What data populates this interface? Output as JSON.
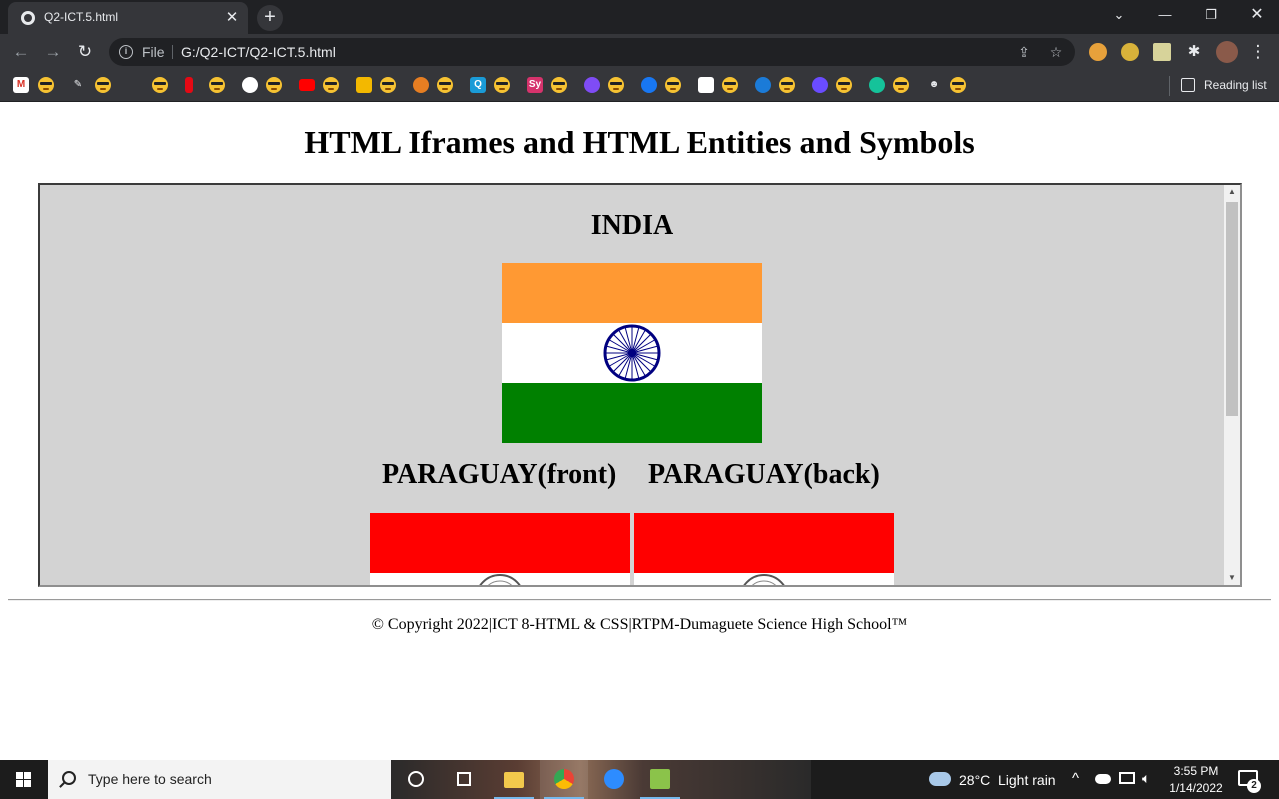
{
  "browser": {
    "tab_title": "Q2-ICT.5.html",
    "tab_close": "✕",
    "new_tab": "+",
    "address_prefix": "File",
    "address_url": "G:/Q2-ICT/Q2-ICT.5.html",
    "reading_list": "Reading list",
    "bookmark_letters": [
      "M",
      "Q",
      "Sy"
    ]
  },
  "page": {
    "title": "HTML Iframes and HTML Entities and Symbols",
    "iframe": {
      "india_heading": "INDIA",
      "paraguay_front_heading": "PARAGUAY(front)",
      "paraguay_back_heading": "PARAGUAY(back)"
    },
    "footer": "© Copyright 2022|ICT 8-HTML & CSS|RTPM-Dumaguete Science High School™"
  },
  "colors": {
    "india_saffron": "#ff9933",
    "india_white": "#ffffff",
    "india_green": "#138808",
    "india_chakra": "#000080",
    "paraguay_red": "#ff0000",
    "iframe_bg": "#d3d3d3"
  },
  "taskbar": {
    "search_placeholder": "Type here to search",
    "temperature": "28°C",
    "weather": "Light rain",
    "time": "3:55 PM",
    "date": "1/14/2022",
    "notifications": "2"
  }
}
